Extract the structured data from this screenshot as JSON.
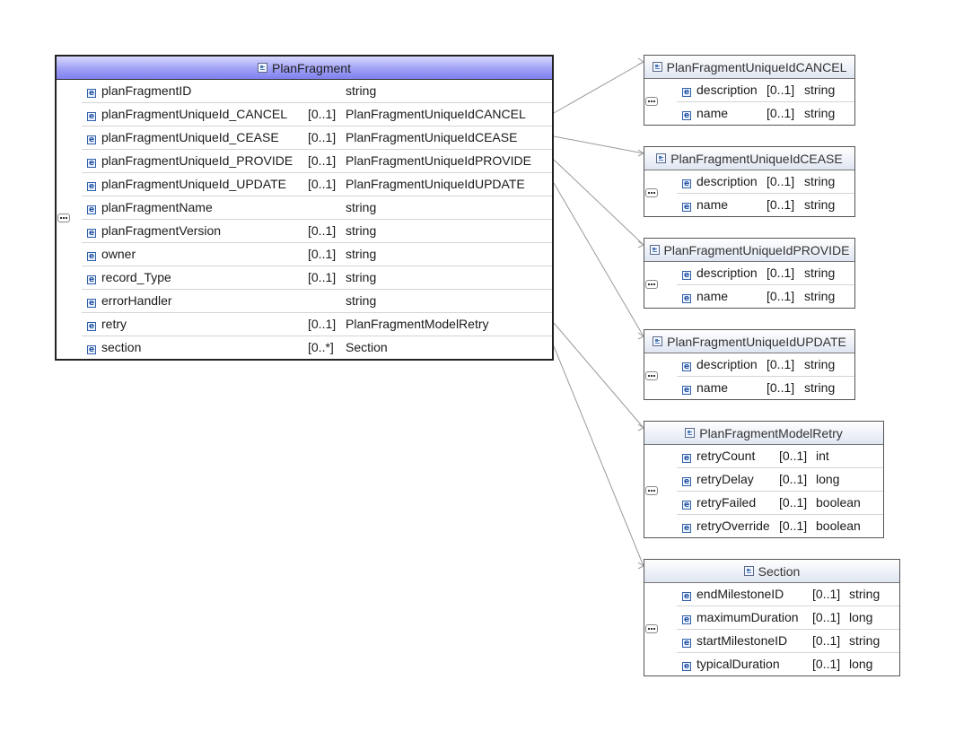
{
  "main": {
    "title": "PlanFragment",
    "icon": "complex-type-icon",
    "rows": [
      {
        "name": "planFragmentID",
        "card": "",
        "type": "string"
      },
      {
        "name": "planFragmentUniqueId_CANCEL",
        "card": "[0..1]",
        "type": "PlanFragmentUniqueIdCANCEL"
      },
      {
        "name": "planFragmentUniqueId_CEASE",
        "card": "[0..1]",
        "type": "PlanFragmentUniqueIdCEASE"
      },
      {
        "name": "planFragmentUniqueId_PROVIDE",
        "card": "[0..1]",
        "type": "PlanFragmentUniqueIdPROVIDE"
      },
      {
        "name": "planFragmentUniqueId_UPDATE",
        "card": "[0..1]",
        "type": "PlanFragmentUniqueIdUPDATE"
      },
      {
        "name": "planFragmentName",
        "card": "",
        "type": "string"
      },
      {
        "name": "planFragmentVersion",
        "card": "[0..1]",
        "type": "string"
      },
      {
        "name": "owner",
        "card": "[0..1]",
        "type": "string"
      },
      {
        "name": "record_Type",
        "card": "[0..1]",
        "type": "string"
      },
      {
        "name": "errorHandler",
        "card": "",
        "type": "string"
      },
      {
        "name": "retry",
        "card": "[0..1]",
        "type": "PlanFragmentModelRetry"
      },
      {
        "name": "section",
        "card": "[0..*]",
        "type": "Section"
      }
    ]
  },
  "types": [
    {
      "title": "PlanFragmentUniqueIdCANCEL",
      "rows": [
        {
          "name": "description",
          "card": "[0..1]",
          "type": "string"
        },
        {
          "name": "name",
          "card": "[0..1]",
          "type": "string"
        }
      ]
    },
    {
      "title": "PlanFragmentUniqueIdCEASE",
      "rows": [
        {
          "name": "description",
          "card": "[0..1]",
          "type": "string"
        },
        {
          "name": "name",
          "card": "[0..1]",
          "type": "string"
        }
      ]
    },
    {
      "title": "PlanFragmentUniqueIdPROVIDE",
      "rows": [
        {
          "name": "description",
          "card": "[0..1]",
          "type": "string"
        },
        {
          "name": "name",
          "card": "[0..1]",
          "type": "string"
        }
      ]
    },
    {
      "title": "PlanFragmentUniqueIdUPDATE",
      "rows": [
        {
          "name": "description",
          "card": "[0..1]",
          "type": "string"
        },
        {
          "name": "name",
          "card": "[0..1]",
          "type": "string"
        }
      ]
    },
    {
      "title": "PlanFragmentModelRetry",
      "rows": [
        {
          "name": "retryCount",
          "card": "[0..1]",
          "type": "int"
        },
        {
          "name": "retryDelay",
          "card": "[0..1]",
          "type": "long"
        },
        {
          "name": "retryFailed",
          "card": "[0..1]",
          "type": "boolean"
        },
        {
          "name": "retryOverride",
          "card": "[0..1]",
          "type": "boolean"
        }
      ]
    },
    {
      "title": "Section",
      "rows": [
        {
          "name": "endMilestoneID",
          "card": "[0..1]",
          "type": "string"
        },
        {
          "name": "maximumDuration",
          "card": "[0..1]",
          "type": "long"
        },
        {
          "name": "startMilestoneID",
          "card": "[0..1]",
          "type": "string"
        },
        {
          "name": "typicalDuration",
          "card": "[0..1]",
          "type": "long"
        }
      ]
    }
  ],
  "element_icon": "element-icon",
  "sequence_icon": "sequence-icon"
}
